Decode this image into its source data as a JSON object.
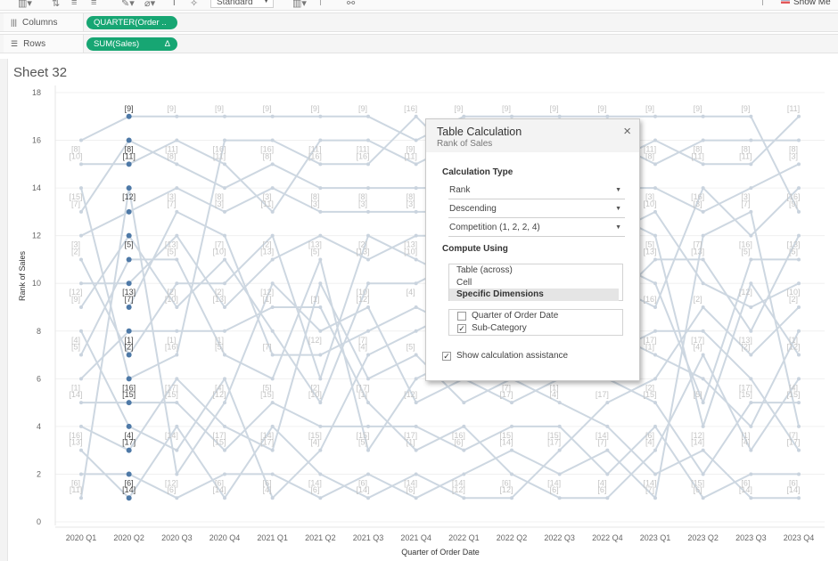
{
  "toolbar": {
    "fit_select": "Standard",
    "show_me": "Show Me"
  },
  "shelves": {
    "columns_label": "Columns",
    "columns_pill": "QUARTER(Order ..",
    "rows_label": "Rows",
    "rows_pill": "SUM(Sales)",
    "rows_pill_badge": "Δ"
  },
  "sheet": {
    "title": "Sheet 32"
  },
  "dialog": {
    "title": "Table Calculation",
    "subtitle": "Rank of Sales",
    "close": "×",
    "calc_type_heading": "Calculation Type",
    "calc_type": "Rank",
    "order": "Descending",
    "rank_type": "Competition (1, 2, 2, 4)",
    "compute_heading": "Compute Using",
    "compute_options": [
      "Table (across)",
      "Cell",
      "Specific Dimensions"
    ],
    "compute_selected": 2,
    "dimensions": [
      {
        "label": "Quarter of Order Date",
        "checked": false
      },
      {
        "label": "Sub-Category",
        "checked": true
      }
    ],
    "assistance_label": "Show calculation assistance",
    "assistance_checked": true
  },
  "colors": {
    "line": "#cdd7e1",
    "highlight": "#4e79a7",
    "pill": "#17a673"
  },
  "chart_data": {
    "type": "line",
    "title": "Sheet 32",
    "xlabel": "Quarter of Order Date",
    "ylabel": "Rank of Sales",
    "ylim": [
      0,
      18
    ],
    "y_ticks": [
      "0",
      "2",
      "4",
      "6",
      "8",
      "10",
      "12",
      "14",
      "16",
      "18"
    ],
    "categories": [
      "2020 Q1",
      "2020 Q2",
      "2020 Q3",
      "2020 Q4",
      "2021 Q1",
      "2021 Q2",
      "2021 Q3",
      "2021 Q4",
      "2022 Q1",
      "2022 Q2",
      "2022 Q3",
      "2022 Q4",
      "2023 Q1",
      "2023 Q2",
      "2023 Q3",
      "2023 Q4"
    ],
    "highlighted_category": 1,
    "series": [
      {
        "ranks": [
          16,
          17,
          17,
          17,
          17,
          17,
          17,
          16,
          17,
          17,
          17,
          17,
          17,
          17,
          17,
          13
        ]
      },
      {
        "ranks": [
          13,
          16,
          15,
          14,
          15,
          14,
          14,
          14,
          14,
          14,
          13,
          12,
          13,
          10,
          9,
          10
        ]
      },
      {
        "ranks": [
          15,
          15,
          16,
          15,
          13,
          16,
          16,
          15,
          16,
          16,
          15,
          14,
          14,
          13,
          14,
          15
        ]
      },
      {
        "ranks": [
          1,
          14,
          2,
          5,
          10,
          8,
          9,
          5,
          6,
          5,
          6,
          7,
          8,
          8,
          6,
          3
        ]
      },
      {
        "ranks": [
          12,
          13,
          14,
          13,
          14,
          13,
          13,
          13,
          13,
          12,
          11,
          10,
          9,
          14,
          12,
          14
        ]
      },
      {
        "ranks": [
          9,
          12,
          9,
          11,
          8,
          5,
          10,
          10,
          11,
          10,
          9,
          8,
          7,
          6,
          4,
          8
        ]
      },
      {
        "ranks": [
          7,
          11,
          11,
          7,
          6,
          11,
          3,
          6,
          7,
          8,
          7,
          6,
          5,
          2,
          5,
          5
        ]
      },
      {
        "ranks": [
          10,
          10,
          12,
          9,
          11,
          12,
          11,
          12,
          12,
          13,
          14,
          15,
          16,
          15,
          15,
          17
        ]
      },
      {
        "ranks": [
          null,
          9,
          13,
          12,
          7,
          7,
          8,
          9,
          8,
          9,
          10,
          11,
          10,
          5,
          11,
          11
        ]
      },
      {
        "ranks": [
          6,
          8,
          8,
          8,
          9,
          9,
          5,
          3,
          4,
          2,
          1,
          1,
          3,
          7,
          3,
          6
        ]
      },
      {
        "ranks": [
          11,
          7,
          10,
          10,
          12,
          6,
          12,
          11,
          10,
          11,
          12,
          13,
          12,
          4,
          10,
          7
        ]
      },
      {
        "ranks": [
          14,
          6,
          7,
          16,
          16,
          15,
          15,
          17,
          15,
          15,
          16,
          16,
          15,
          16,
          16,
          16
        ]
      },
      {
        "ranks": [
          5,
          5,
          5,
          3,
          5,
          4,
          4,
          4,
          3,
          4,
          4,
          2,
          4,
          1,
          2,
          2
        ]
      },
      {
        "ranks": [
          8,
          4,
          3,
          6,
          1,
          3,
          7,
          8,
          9,
          7,
          8,
          9,
          11,
          11,
          8,
          12
        ]
      },
      {
        "ranks": [
          4,
          3,
          6,
          4,
          3,
          10,
          6,
          7,
          5,
          6,
          5,
          4,
          2,
          3,
          1,
          1
        ]
      },
      {
        "ranks": [
          2,
          2,
          1,
          2,
          2,
          1,
          2,
          1,
          2,
          3,
          2,
          3,
          1,
          12,
          13,
          4
        ]
      },
      {
        "ranks": [
          3,
          1,
          4,
          1,
          4,
          2,
          1,
          2,
          1,
          1,
          3,
          5,
          6,
          9,
          7,
          9
        ]
      }
    ],
    "point_labels_by_rank": [
      [
        "[11]",
        "[6]",
        "[13]",
        "[16]",
        "[14]",
        "[1]",
        "[5]",
        "[4]",
        "[9]",
        "[12]",
        "[2]",
        "[3]",
        "[7]",
        "[15]",
        "[10]",
        "[8]",
        ""
      ],
      [
        "[14]",
        "[6]",
        "[17]",
        "[4]",
        "[15]",
        "[16]",
        "[2]",
        "[1]",
        "[7]",
        "[13]",
        "",
        "[5]",
        "",
        "[12]",
        "[11]",
        "[8]",
        "[9]"
      ],
      [
        "[6]",
        "[12]",
        "",
        "[14]",
        "[15]",
        "[17]",
        "[16]",
        "[1]",
        "[10]",
        "[2]",
        "[5]",
        "[13]",
        "[7]",
        "[3]",
        "[8]",
        "[11]",
        "[9]"
      ],
      [
        "[14]",
        "[6]",
        "[15]",
        "[17]",
        "[12]",
        "[4]",
        "[5]",
        "[1]",
        "[13]",
        "[2]",
        "[10]",
        "[7]",
        "[3]",
        "[8]",
        "[11]",
        "[16]",
        "[9]"
      ],
      [
        "[4]",
        "[6]",
        "[17]",
        "[14]",
        "[15]",
        "[5]",
        "[7]",
        "",
        "[1]",
        "[12]",
        "[13]",
        "[2]",
        "[11]",
        "[3]",
        "[8]",
        "[16]",
        "[9]"
      ],
      [
        "[6]",
        "[14]",
        "[4]",
        "[15]",
        "[10]",
        "[2]",
        "",
        "[12]",
        "[1]",
        "",
        "[5]",
        "[13]",
        "[3]",
        "[8]",
        "[16]",
        "[11]",
        "[9]"
      ],
      [
        "[14]",
        "[6]",
        "[5]",
        "[15]",
        "[1]",
        "[17]",
        "[4]",
        "[7]",
        "[12]",
        "[10]",
        "[13]",
        "[2]",
        "[3]",
        "[8]",
        "[16]",
        "[11]",
        "[9]"
      ],
      [
        "[6]",
        "[14]",
        "[1]",
        "[17]",
        "[12]",
        "",
        "[5]",
        "",
        "",
        "[4]",
        "[10]",
        "[13]",
        "[3]",
        "[8]",
        "[11]",
        "[9]",
        "[16]"
      ],
      [
        "[12]",
        "[14]",
        "[6]",
        "[16]",
        "",
        "",
        "",
        "",
        "",
        "",
        "",
        "",
        "",
        "",
        "",
        "",
        "[9]"
      ],
      [
        "[12]",
        "[6]",
        "[14]",
        "[15]",
        "[17]",
        "[7]",
        "",
        "",
        "",
        "",
        "",
        "",
        "",
        "",
        "",
        "",
        "[9]"
      ],
      [
        "[6]",
        "[14]",
        "[17]",
        "[15]",
        "[4]",
        "[1]",
        "",
        "",
        "",
        "",
        "",
        "",
        "",
        "",
        "",
        "",
        "[9]"
      ],
      [
        "[6]",
        "[4]",
        "[7]",
        "[14]",
        "[17]",
        "",
        "",
        "",
        "",
        "",
        "",
        "",
        "",
        "",
        "",
        "",
        "[9]"
      ],
      [
        "[7]",
        "[14]",
        "[4]",
        "[6]",
        "[15]",
        "[2]",
        "[1]",
        "[17]",
        "[16]",
        "",
        "[13]",
        "[5]",
        "[10]",
        "[3]",
        "[8]",
        "[11]",
        "[9]"
      ],
      [
        "[6]",
        "[15]",
        "[14]",
        "[12]",
        "[5]",
        "",
        "[4]",
        "[17]",
        "[2]",
        "",
        "[13]",
        "[7]",
        "[3]",
        "[16]",
        "[11]",
        "[8]",
        "[9]"
      ],
      [
        "[14]",
        "[6]",
        "[4]",
        "[1]",
        "[15]",
        "[17]",
        "[2]",
        "[13]",
        "",
        "[12]",
        "[5]",
        "[16]",
        "[7]",
        "[3]",
        "[11]",
        "[8]",
        "[9]"
      ],
      [
        "[14]",
        "[6]",
        "[17]",
        "[7]",
        "[15]",
        "[4]",
        "[12]",
        "[1]",
        "[2]",
        "[10]",
        "[5]",
        "[13]",
        "[9]",
        "[16]",
        "[3]",
        "[8]",
        "[11]"
      ]
    ]
  }
}
